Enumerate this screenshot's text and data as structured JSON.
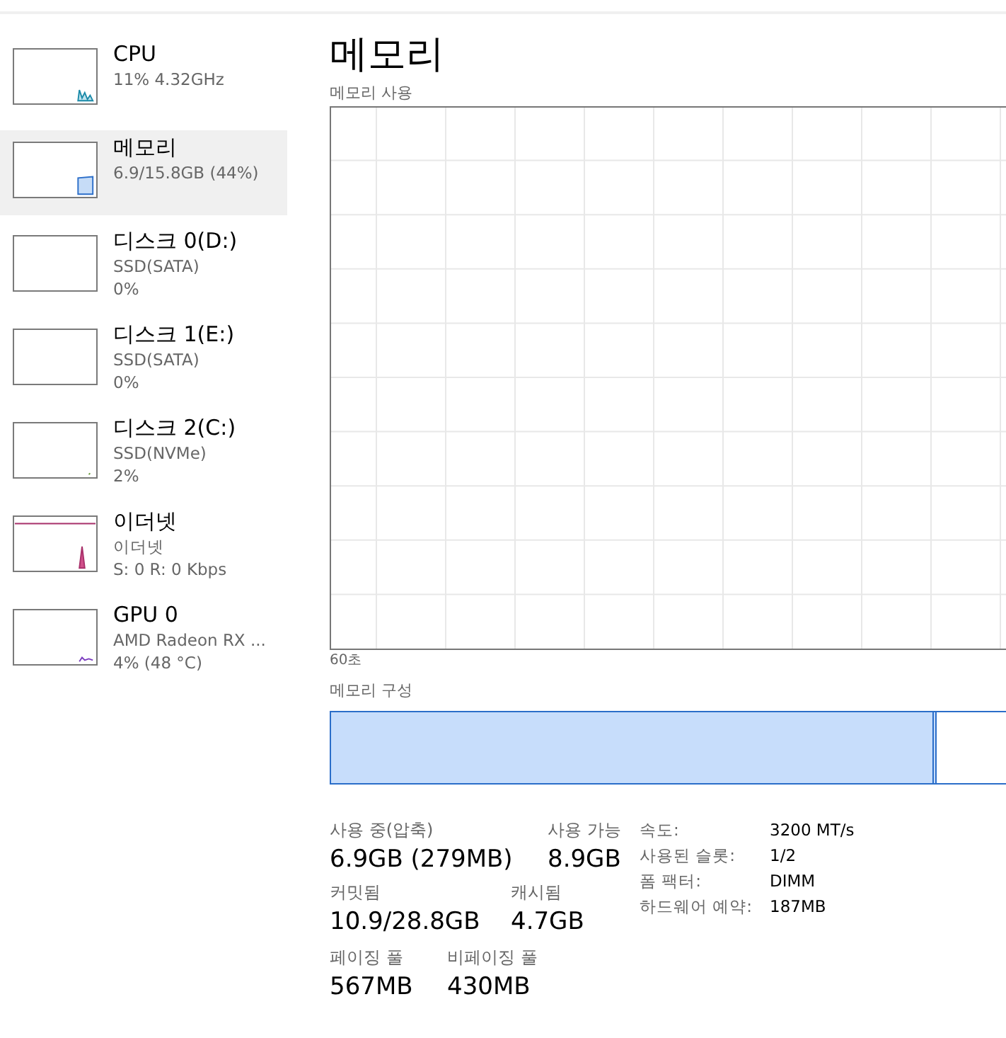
{
  "sidebar": {
    "items": [
      {
        "kind": "cpu",
        "title": "CPU",
        "lines": [
          "11% 4.32GHz"
        ],
        "selected": false
      },
      {
        "kind": "memory",
        "title": "메모리",
        "lines": [
          "6.9/15.8GB (44%)"
        ],
        "selected": true
      },
      {
        "kind": "disk",
        "title": "디스크 0(D:)",
        "lines": [
          "SSD(SATA)",
          "0%"
        ],
        "selected": false
      },
      {
        "kind": "disk",
        "title": "디스크 1(E:)",
        "lines": [
          "SSD(SATA)",
          "0%"
        ],
        "selected": false
      },
      {
        "kind": "disk2",
        "title": "디스크 2(C:)",
        "lines": [
          "SSD(NVMe)",
          "2%"
        ],
        "selected": false
      },
      {
        "kind": "ethernet",
        "title": "이더넷",
        "lines": [
          "이더넷",
          "S: 0 R: 0 Kbps"
        ],
        "selected": false
      },
      {
        "kind": "gpu",
        "title": "GPU 0",
        "lines": [
          "AMD Radeon RX ...",
          "4% (48 °C)"
        ],
        "selected": false
      }
    ]
  },
  "main": {
    "title": "메모리",
    "usage_label": "메모리 사용",
    "time_label": "60초",
    "composition_label": "메모리 구성",
    "composition": {
      "level": 0.877
    },
    "stats": {
      "in_use": {
        "label": "사용 중(압축)",
        "value": "6.9GB (279MB)"
      },
      "available": {
        "label": "사용 가능",
        "value": "8.9GB"
      },
      "committed": {
        "label": "커밋됨",
        "value": "10.9/28.8GB"
      },
      "cached": {
        "label": "캐시됨",
        "value": "4.7GB"
      },
      "paged": {
        "label": "페이징 풀",
        "value": "567MB"
      },
      "nonpaged": {
        "label": "비페이징 풀",
        "value": "430MB"
      }
    },
    "details": [
      {
        "label": "속도:",
        "value": "3200 MT/s"
      },
      {
        "label": "사용된 슬롯:",
        "value": "1/2"
      },
      {
        "label": "폼 팩터:",
        "value": "DIMM"
      },
      {
        "label": "하드웨어 예약:",
        "value": "187MB"
      }
    ]
  }
}
